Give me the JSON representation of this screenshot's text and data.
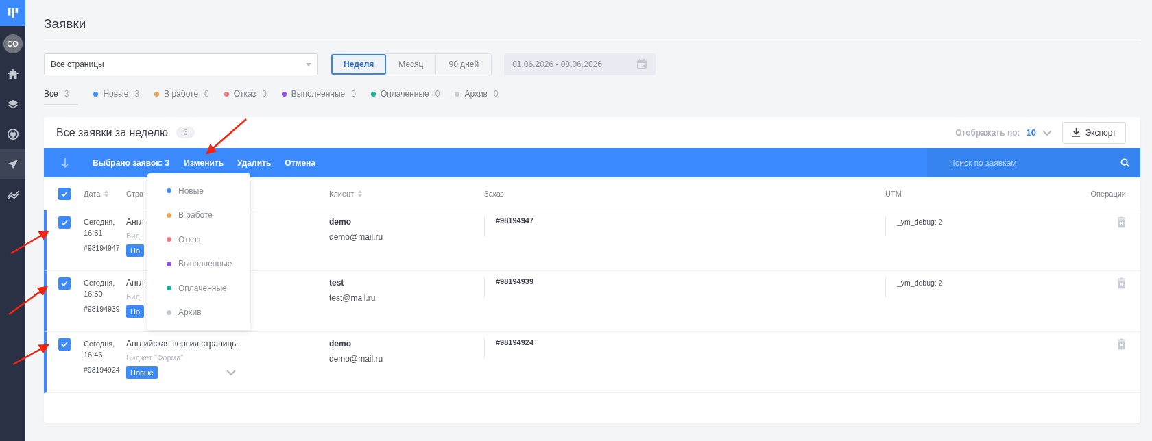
{
  "sidebar": {
    "items": [
      {
        "kind": "logo",
        "selected": false
      },
      {
        "kind": "avatar",
        "label": "CO",
        "selected": false
      },
      {
        "kind": "home",
        "selected": false
      },
      {
        "kind": "layers",
        "selected": false
      },
      {
        "kind": "plug",
        "selected": false
      },
      {
        "kind": "plane",
        "selected": true
      },
      {
        "kind": "chart",
        "selected": false
      }
    ]
  },
  "page_title": "Заявки",
  "filters": {
    "page_select": {
      "value": "Все страницы"
    },
    "periods": [
      {
        "label": "Неделя",
        "selected": true
      },
      {
        "label": "Месяц",
        "selected": false
      },
      {
        "label": "90 дней",
        "selected": false
      }
    ],
    "date_range": {
      "value": "01.06.2026 - 08.06.2026"
    }
  },
  "status_tabs": [
    {
      "label": "Все",
      "count": "3",
      "selected": true
    },
    {
      "label": "Новые",
      "count": "3",
      "color": "#3d8bfd",
      "selected": false
    },
    {
      "label": "В работе",
      "count": "0",
      "color": "#f0a555",
      "selected": false
    },
    {
      "label": "Отказ",
      "count": "0",
      "color": "#f6787f",
      "selected": false
    },
    {
      "label": "Выполненные",
      "count": "0",
      "color": "#9b4de8",
      "selected": false
    },
    {
      "label": "Оплаченные",
      "count": "0",
      "color": "#14b39b",
      "selected": false
    },
    {
      "label": "Архив",
      "count": "0",
      "color": "#c5c9d0",
      "selected": false
    }
  ],
  "card": {
    "title": "Все заявки за неделю",
    "count": "3",
    "per_page_label": "Отображать по:",
    "per_page_value": "10",
    "export_button": "Экспорт",
    "bulk_bar": {
      "selected_label": "Выбрано заявок: 3",
      "actions": [
        "Изменить",
        "Удалить",
        "Отмена"
      ],
      "search_placeholder": "Поиск по заявкам"
    },
    "status_menu": [
      {
        "label": "Новые",
        "color": "#3d8bfd"
      },
      {
        "label": "В работе",
        "color": "#f0a555"
      },
      {
        "label": "Отказ",
        "color": "#f6787f"
      },
      {
        "label": "Выполненные",
        "color": "#9b4de8"
      },
      {
        "label": "Оплаченные",
        "color": "#14b39b"
      },
      {
        "label": "Архив",
        "color": "#c5c9d0"
      }
    ],
    "table": {
      "select_all_checked": true,
      "columns": [
        {
          "label": "Дата",
          "sortable": true
        },
        {
          "label": "Стра"
        },
        {
          "label": "Клиент",
          "sortable": true
        },
        {
          "label": "Заказ",
          "sortable": false
        },
        {
          "label": "UTM",
          "sortable": false
        },
        {
          "label": "Операции",
          "sortable": false
        }
      ],
      "rows": [
        {
          "checked": true,
          "date": "Сегодня, 16:51",
          "id": "#98194947",
          "page": "Англ",
          "widget": "Вид",
          "status": "Но",
          "expand_visible": false,
          "client_name": "demo",
          "client_email": "demo@mail.ru",
          "order": "#98194947",
          "utm": "_ym_debug: 2"
        },
        {
          "checked": true,
          "date": "Сегодня, 16:50",
          "id": "#98194939",
          "page": "Англ",
          "widget": "Вид",
          "status": "Но",
          "expand_visible": false,
          "client_name": "test",
          "client_email": "test@mail.ru",
          "order": "#98194939",
          "utm": "_ym_debug: 2"
        },
        {
          "checked": true,
          "date": "Сегодня, 16:46",
          "id": "#98194924",
          "page": "Английская версия страницы",
          "widget": "Виджет \"Форма\"",
          "status": "Новые",
          "expand_visible": true,
          "client_name": "demo",
          "client_email": "demo@mail.ru",
          "order": "#98194924"
        }
      ]
    }
  }
}
